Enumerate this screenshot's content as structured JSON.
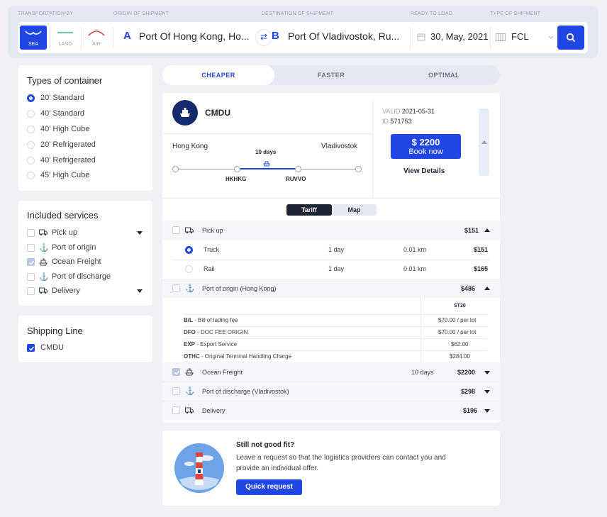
{
  "topbar": {
    "labels": {
      "transport": "TRANSPORTATION BY",
      "origin": "ORIGIN OF SHIPMENT",
      "destination": "DESTINATION OF SHIPMENT",
      "ready": "READY TO LOAD",
      "type": "TYPE OF SHIPMENT"
    },
    "modes": [
      {
        "label": "SEA",
        "icon": "wave-icon",
        "active": true
      },
      {
        "label": "LAND",
        "icon": "road-icon",
        "active": false
      },
      {
        "label": "AIR",
        "icon": "arc-icon",
        "active": false
      }
    ],
    "origin_letter": "A",
    "origin_value": "Port Of Hong Kong, Ho...",
    "swap_icon": "⇄",
    "destination_letter": "B",
    "destination_value": "Port Of Vladivostok, Ru...",
    "date_value": "30, May, 2021",
    "shipment_type_value": "FCL"
  },
  "container_types": {
    "title": "Types of container",
    "options": [
      {
        "label": "20' Standard",
        "selected": true
      },
      {
        "label": "40' Standard",
        "selected": false
      },
      {
        "label": "40' High Cube",
        "selected": false
      },
      {
        "label": "20' Refrigerated",
        "selected": false
      },
      {
        "label": "40' Refrigerated",
        "selected": false
      },
      {
        "label": "45' High Cube",
        "selected": false
      }
    ]
  },
  "services": {
    "title": "Included services",
    "items": [
      {
        "label": "Pick up",
        "icon": "truck-icon",
        "checked": false,
        "expandable": true
      },
      {
        "label": "Port of origin",
        "icon": "anchor-icon",
        "checked": false,
        "expandable": false
      },
      {
        "label": "Ocean Freight",
        "icon": "ship-icon",
        "checked": true,
        "expandable": false
      },
      {
        "label": "Port of discharge",
        "icon": "anchor-icon",
        "checked": false,
        "expandable": false
      },
      {
        "label": "Delivery",
        "icon": "truck-icon",
        "checked": false,
        "expandable": true
      }
    ]
  },
  "shipping_line": {
    "title": "Shipping Line",
    "items": [
      {
        "label": "CMDU",
        "checked": true
      }
    ]
  },
  "tabs": [
    "CHEAPER",
    "FASTER",
    "OPTIMAL"
  ],
  "result": {
    "carrier": "CMDU",
    "origin_city": "Hong Kong",
    "destination_city": "Vladivostok",
    "transit": "10 days",
    "origin_code": "HKHKG",
    "destination_code": "RUVVO",
    "valid_label": "VALID",
    "valid_value": "2021-05-31",
    "id_label": "ID",
    "id_value": "571753",
    "price": "$ 2200",
    "book_label": "Book now",
    "details_label": "View Details",
    "toggle": [
      "Tariff",
      "Map"
    ],
    "pickup": {
      "label": "Pick up",
      "value": "$151"
    },
    "pickup_options": [
      {
        "label": "Truck",
        "days": "1 day",
        "distance": "0.01 km",
        "price": "$151",
        "selected": true
      },
      {
        "label": "Rail",
        "days": "1 day",
        "distance": "0.01 km",
        "price": "$165",
        "selected": false
      }
    ],
    "origin_port": {
      "label": "Port of origin (Hong Kong)",
      "value": "$486"
    },
    "fee_column": "ST20",
    "fees": [
      {
        "code": "B/L",
        "desc": " - Bill of lading fee",
        "value": "$70.00 / per lot"
      },
      {
        "code": "DFO",
        "desc": " - DOC FEE ORIGIN",
        "value": "$70.00 / per lot"
      },
      {
        "code": "EXP",
        "desc": " - Export Service",
        "value": "$62.00"
      },
      {
        "code": "OTHC",
        "desc": " - Original Terminal Handling Charge",
        "value": "$284.00"
      }
    ],
    "ocean": {
      "label": "Ocean Freight",
      "days": "10 days",
      "value": "$2200"
    },
    "discharge": {
      "label": "Port of discharge (Vladivostok)",
      "value": "$298"
    },
    "delivery": {
      "label": "Delivery",
      "value": "$196"
    }
  },
  "bottom": {
    "title": "Still not good fit?",
    "text_line1": "Leave a request so that the logistics providers can contact you and",
    "text_line2": "provide an individual offer.",
    "button": "Quick request"
  },
  "colors": {
    "accent": "#2146e6",
    "background": "#eff1f7",
    "air": "#e0443b",
    "land": "#3bb873"
  }
}
